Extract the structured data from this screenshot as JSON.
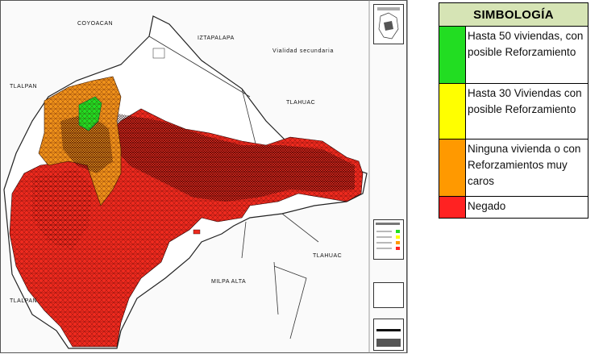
{
  "map": {
    "labels": {
      "coyoacan": "COYOACAN",
      "iztapalapa": "IZTAPALAPA",
      "vialidad": "Vialidad secundaria",
      "tlalpan_top": "TLALPAN",
      "tlahuac_top": "TLAHUAC",
      "tlahuac_bottom": "TLAHUAC",
      "milpa_alta": "MILPA ALTA",
      "tlalpan_bottom": "TLALPAN"
    }
  },
  "legend": {
    "title": "SIMBOLOGÍA",
    "items": [
      {
        "color": "#22dd22",
        "text": "Hasta 50 viviendas, con posible Reforzamiento"
      },
      {
        "color": "#ffff00",
        "text": "Hasta 30 Viviendas con posible Reforzamiento"
      },
      {
        "color": "#ff9900",
        "text": "Ninguna vivienda o con Reforzamientos muy caros"
      },
      {
        "color": "#ff2222",
        "text": "Negado"
      }
    ]
  },
  "colors": {
    "green": "#22dd22",
    "yellow": "#ffff00",
    "orange": "#f0921a",
    "red": "#ee2a1e",
    "legend_header": "#d6e4b5"
  }
}
